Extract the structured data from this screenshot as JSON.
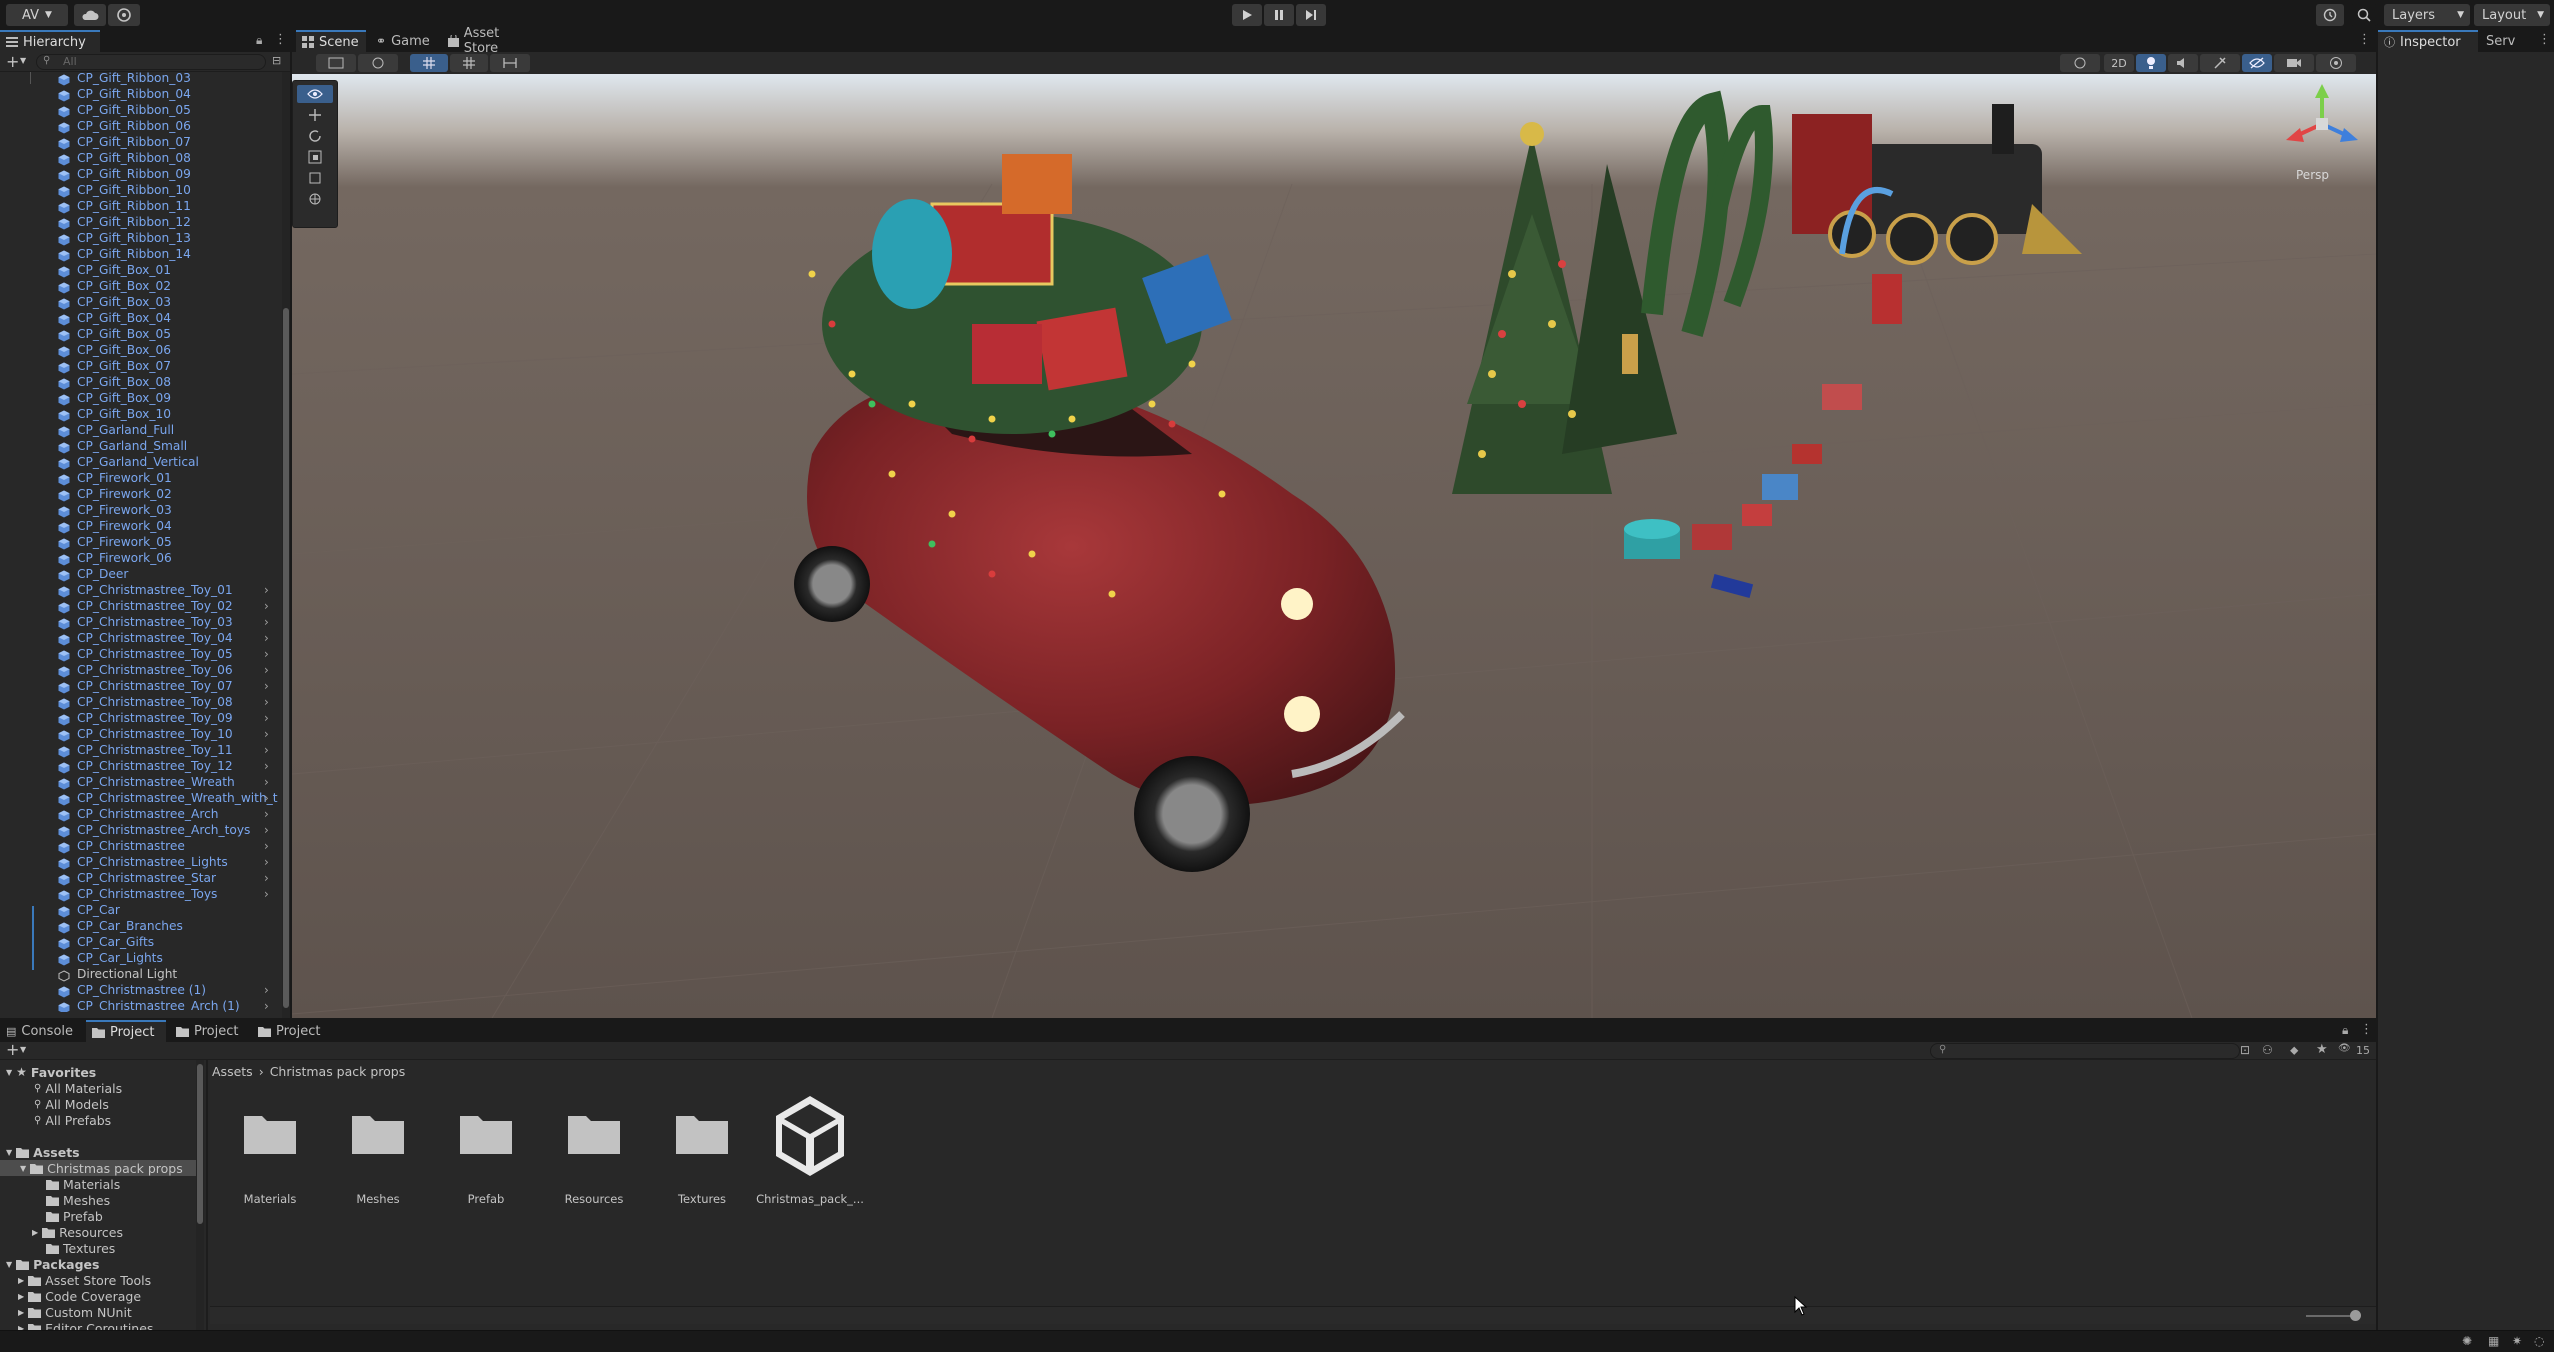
{
  "topbar": {
    "account": "AV",
    "layers": "Layers",
    "layout": "Layout"
  },
  "tabs": {
    "hierarchy": "Hierarchy",
    "scene": "Scene",
    "game": "Game",
    "asset_store": "Asset Store",
    "inspector": "Inspector",
    "services": "Serv",
    "console": "Console",
    "project1": "Project",
    "project2": "Project",
    "project3": "Project"
  },
  "hierarchy": {
    "search_placeholder": "All",
    "items": [
      {
        "label": "CP_Gift_Ribbon_03",
        "arrow": false,
        "kind": "prefab"
      },
      {
        "label": "CP_Gift_Ribbon_04",
        "arrow": false,
        "kind": "prefab"
      },
      {
        "label": "CP_Gift_Ribbon_05",
        "arrow": false,
        "kind": "prefab"
      },
      {
        "label": "CP_Gift_Ribbon_06",
        "arrow": false,
        "kind": "prefab"
      },
      {
        "label": "CP_Gift_Ribbon_07",
        "arrow": false,
        "kind": "prefab"
      },
      {
        "label": "CP_Gift_Ribbon_08",
        "arrow": false,
        "kind": "prefab"
      },
      {
        "label": "CP_Gift_Ribbon_09",
        "arrow": false,
        "kind": "prefab"
      },
      {
        "label": "CP_Gift_Ribbon_10",
        "arrow": false,
        "kind": "prefab"
      },
      {
        "label": "CP_Gift_Ribbon_11",
        "arrow": false,
        "kind": "prefab"
      },
      {
        "label": "CP_Gift_Ribbon_12",
        "arrow": false,
        "kind": "prefab"
      },
      {
        "label": "CP_Gift_Ribbon_13",
        "arrow": false,
        "kind": "prefab"
      },
      {
        "label": "CP_Gift_Ribbon_14",
        "arrow": false,
        "kind": "prefab"
      },
      {
        "label": "CP_Gift_Box_01",
        "arrow": false,
        "kind": "prefab"
      },
      {
        "label": "CP_Gift_Box_02",
        "arrow": false,
        "kind": "prefab"
      },
      {
        "label": "CP_Gift_Box_03",
        "arrow": false,
        "kind": "prefab"
      },
      {
        "label": "CP_Gift_Box_04",
        "arrow": false,
        "kind": "prefab"
      },
      {
        "label": "CP_Gift_Box_05",
        "arrow": false,
        "kind": "prefab"
      },
      {
        "label": "CP_Gift_Box_06",
        "arrow": false,
        "kind": "prefab"
      },
      {
        "label": "CP_Gift_Box_07",
        "arrow": false,
        "kind": "prefab"
      },
      {
        "label": "CP_Gift_Box_08",
        "arrow": false,
        "kind": "prefab"
      },
      {
        "label": "CP_Gift_Box_09",
        "arrow": false,
        "kind": "prefab"
      },
      {
        "label": "CP_Gift_Box_10",
        "arrow": false,
        "kind": "prefab"
      },
      {
        "label": "CP_Garland_Full",
        "arrow": false,
        "kind": "prefab"
      },
      {
        "label": "CP_Garland_Small",
        "arrow": false,
        "kind": "prefab"
      },
      {
        "label": "CP_Garland_Vertical",
        "arrow": false,
        "kind": "prefab"
      },
      {
        "label": "CP_Firework_01",
        "arrow": false,
        "kind": "prefab"
      },
      {
        "label": "CP_Firework_02",
        "arrow": false,
        "kind": "prefab"
      },
      {
        "label": "CP_Firework_03",
        "arrow": false,
        "kind": "prefab"
      },
      {
        "label": "CP_Firework_04",
        "arrow": false,
        "kind": "prefab"
      },
      {
        "label": "CP_Firework_05",
        "arrow": false,
        "kind": "prefab"
      },
      {
        "label": "CP_Firework_06",
        "arrow": false,
        "kind": "prefab"
      },
      {
        "label": "CP_Deer",
        "arrow": false,
        "kind": "prefab"
      },
      {
        "label": "CP_Christmastree_Toy_01",
        "arrow": true,
        "kind": "prefab"
      },
      {
        "label": "CP_Christmastree_Toy_02",
        "arrow": true,
        "kind": "prefab"
      },
      {
        "label": "CP_Christmastree_Toy_03",
        "arrow": true,
        "kind": "prefab"
      },
      {
        "label": "CP_Christmastree_Toy_04",
        "arrow": true,
        "kind": "prefab"
      },
      {
        "label": "CP_Christmastree_Toy_05",
        "arrow": true,
        "kind": "prefab"
      },
      {
        "label": "CP_Christmastree_Toy_06",
        "arrow": true,
        "kind": "prefab"
      },
      {
        "label": "CP_Christmastree_Toy_07",
        "arrow": true,
        "kind": "prefab"
      },
      {
        "label": "CP_Christmastree_Toy_08",
        "arrow": true,
        "kind": "prefab"
      },
      {
        "label": "CP_Christmastree_Toy_09",
        "arrow": true,
        "kind": "prefab"
      },
      {
        "label": "CP_Christmastree_Toy_10",
        "arrow": true,
        "kind": "prefab"
      },
      {
        "label": "CP_Christmastree_Toy_11",
        "arrow": true,
        "kind": "prefab"
      },
      {
        "label": "CP_Christmastree_Toy_12",
        "arrow": true,
        "kind": "prefab"
      },
      {
        "label": "CP_Christmastree_Wreath",
        "arrow": true,
        "kind": "prefab"
      },
      {
        "label": "CP_Christmastree_Wreath_with_t",
        "arrow": true,
        "kind": "prefab"
      },
      {
        "label": "CP_Christmastree_Arch",
        "arrow": true,
        "kind": "prefab"
      },
      {
        "label": "CP_Christmastree_Arch_toys",
        "arrow": true,
        "kind": "prefab"
      },
      {
        "label": "CP_Christmastree",
        "arrow": true,
        "kind": "prefab"
      },
      {
        "label": "CP_Christmastree_Lights",
        "arrow": true,
        "kind": "prefab"
      },
      {
        "label": "CP_Christmastree_Star",
        "arrow": true,
        "kind": "prefab"
      },
      {
        "label": "CP_Christmastree_Toys",
        "arrow": true,
        "kind": "prefab"
      },
      {
        "label": "CP_Car",
        "arrow": false,
        "kind": "prefab"
      },
      {
        "label": "CP_Car_Branches",
        "arrow": false,
        "kind": "prefab"
      },
      {
        "label": "CP_Car_Gifts",
        "arrow": false,
        "kind": "prefab"
      },
      {
        "label": "CP_Car_Lights",
        "arrow": false,
        "kind": "prefab"
      },
      {
        "label": "Directional Light",
        "arrow": false,
        "kind": "object"
      },
      {
        "label": "CP_Christmastree (1)",
        "arrow": true,
        "kind": "prefab"
      },
      {
        "label": "CP_Christmastree_Arch (1)",
        "arrow": true,
        "kind": "prefab"
      }
    ]
  },
  "scene": {
    "mode_2d": "2D",
    "persp": "Persp"
  },
  "project": {
    "favorites_title": "Favorites",
    "favorites": [
      "All Materials",
      "All Models",
      "All Prefabs"
    ],
    "assets_title": "Assets",
    "selected_folder": "Christmas pack props",
    "subfolders": [
      "Materials",
      "Meshes",
      "Prefab",
      "Resources",
      "Textures"
    ],
    "packages_title": "Packages",
    "packages": [
      "Asset Store Tools",
      "Code Coverage",
      "Custom NUnit",
      "Editor Coroutines"
    ],
    "breadcrumb": [
      "Assets",
      "Christmas pack props"
    ],
    "grid_items": [
      "Materials",
      "Meshes",
      "Prefab",
      "Resources",
      "Textures",
      "Christmas_pack_..."
    ],
    "hidden_count": "15"
  },
  "colors": {
    "accent": "#3a79bb",
    "prefab_text": "#7aa6ee",
    "panel": "#282828",
    "background": "#191919"
  }
}
